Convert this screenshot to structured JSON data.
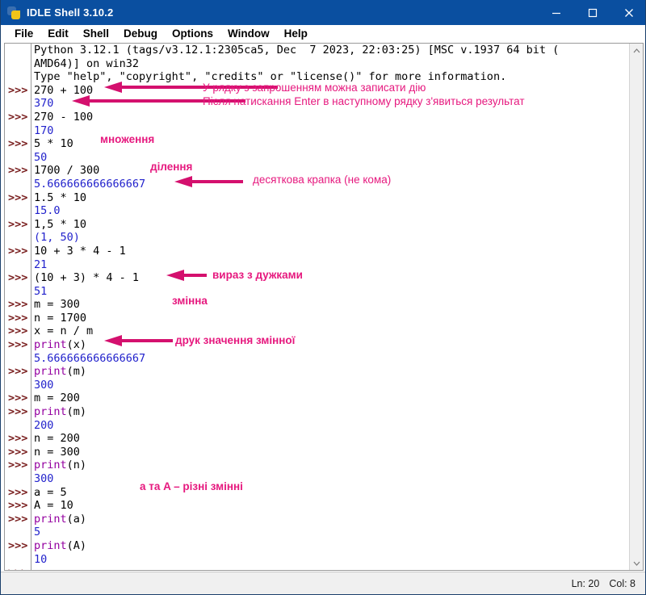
{
  "window": {
    "title": "IDLE Shell 3.10.2",
    "icon": "python-idle-icon",
    "minimize": "–",
    "maximize": "☐",
    "close": "×"
  },
  "menubar": {
    "items": [
      {
        "label": "File"
      },
      {
        "label": "Edit"
      },
      {
        "label": "Shell"
      },
      {
        "label": "Debug"
      },
      {
        "label": "Options"
      },
      {
        "label": "Window"
      },
      {
        "label": "Help"
      }
    ]
  },
  "shell": {
    "prompt": ">>>",
    "banner": [
      "Python 3.12.1 (tags/v3.12.1:2305ca5, Dec  7 2023, 22:03:25) [MSC v.1937 64 bit (",
      "AMD64)] on win32",
      "Type \"help\", \"copyright\", \"credits\" or \"license()\" for more information."
    ],
    "lines": [
      {
        "prompt": true,
        "kind": "input",
        "text": "270 + 100"
      },
      {
        "prompt": false,
        "kind": "output",
        "text": "370"
      },
      {
        "prompt": true,
        "kind": "input",
        "text": "270 - 100"
      },
      {
        "prompt": false,
        "kind": "output",
        "text": "170"
      },
      {
        "prompt": true,
        "kind": "input",
        "text": "5 * 10"
      },
      {
        "prompt": false,
        "kind": "output",
        "text": "50"
      },
      {
        "prompt": true,
        "kind": "input",
        "text": "1700 / 300"
      },
      {
        "prompt": false,
        "kind": "output",
        "text": "5.666666666666667"
      },
      {
        "prompt": true,
        "kind": "input",
        "text": "1.5 * 10"
      },
      {
        "prompt": false,
        "kind": "output",
        "text": "15.0"
      },
      {
        "prompt": true,
        "kind": "input",
        "text": "1,5 * 10"
      },
      {
        "prompt": false,
        "kind": "output",
        "text": "(1, 50)"
      },
      {
        "prompt": true,
        "kind": "input",
        "text": "10 + 3 * 4 - 1"
      },
      {
        "prompt": false,
        "kind": "output",
        "text": "21"
      },
      {
        "prompt": true,
        "kind": "input",
        "text": "(10 + 3) * 4 - 1"
      },
      {
        "prompt": false,
        "kind": "output",
        "text": "51"
      },
      {
        "prompt": true,
        "kind": "input",
        "text": "m = 300"
      },
      {
        "prompt": true,
        "kind": "input",
        "text": "n = 1700"
      },
      {
        "prompt": true,
        "kind": "input",
        "text": "x = n / m"
      },
      {
        "prompt": true,
        "kind": "call",
        "keyword": "print",
        "rest": "(x)"
      },
      {
        "prompt": false,
        "kind": "output",
        "text": "5.666666666666667"
      },
      {
        "prompt": true,
        "kind": "call",
        "keyword": "print",
        "rest": "(m)"
      },
      {
        "prompt": false,
        "kind": "output",
        "text": "300"
      },
      {
        "prompt": true,
        "kind": "input",
        "text": "m = 200"
      },
      {
        "prompt": true,
        "kind": "call",
        "keyword": "print",
        "rest": "(m)"
      },
      {
        "prompt": false,
        "kind": "output",
        "text": "200"
      },
      {
        "prompt": true,
        "kind": "input",
        "text": "n = 200"
      },
      {
        "prompt": true,
        "kind": "input",
        "text": "n = 300"
      },
      {
        "prompt": true,
        "kind": "call",
        "keyword": "print",
        "rest": "(n)"
      },
      {
        "prompt": false,
        "kind": "output",
        "text": "300"
      },
      {
        "prompt": true,
        "kind": "input",
        "text": "a = 5"
      },
      {
        "prompt": true,
        "kind": "input",
        "text": "A = 10"
      },
      {
        "prompt": true,
        "kind": "call",
        "keyword": "print",
        "rest": "(a)"
      },
      {
        "prompt": false,
        "kind": "output",
        "text": "5"
      },
      {
        "prompt": true,
        "kind": "call",
        "keyword": "print",
        "rest": "(A)"
      },
      {
        "prompt": false,
        "kind": "output",
        "text": "10"
      },
      {
        "prompt": true,
        "kind": "input",
        "text": ""
      }
    ]
  },
  "annotations": [
    {
      "id": "anno-prompt-line",
      "text": "У рядку з запрошенням можна записати дію"
    },
    {
      "id": "anno-enter-result",
      "text": "Після натискання Enter в наступному рядку з'явиться результат"
    },
    {
      "id": "anno-multiplication",
      "text": "множення"
    },
    {
      "id": "anno-division",
      "text": "ділення"
    },
    {
      "id": "anno-decimal-point",
      "text": "десяткова крапка (не кома)"
    },
    {
      "id": "anno-parentheses",
      "text": "вираз з дужками"
    },
    {
      "id": "anno-variable",
      "text": "змінна"
    },
    {
      "id": "anno-print-value",
      "text": "друк значення змінної"
    },
    {
      "id": "anno-case-sensitive",
      "text": "a та A – різні змінні"
    }
  ],
  "statusbar": {
    "line": "Ln: 20",
    "column": "Col: 8"
  },
  "colors": {
    "titlebar": "#0a4fa0",
    "prompt": "#7a2020",
    "output": "#2222cc",
    "keyword": "#9400a0",
    "annotation": "#e6187e"
  }
}
